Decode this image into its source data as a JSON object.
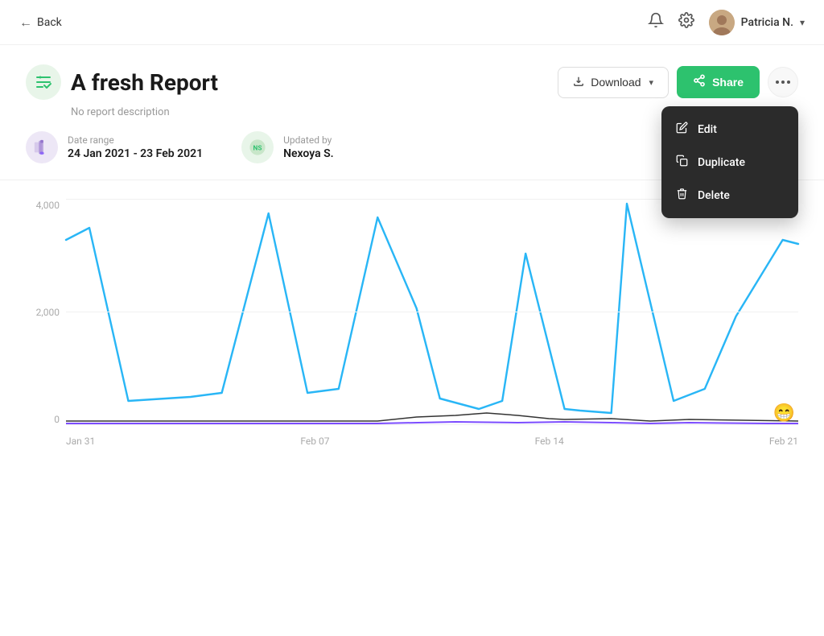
{
  "nav": {
    "back_label": "Back",
    "user_name": "Patricia N.",
    "bell_icon": "🔔",
    "gear_icon": "⚙",
    "chevron": "▾"
  },
  "header": {
    "report_icon": "🖱",
    "report_title": "A fresh Report",
    "report_description": "No report description",
    "download_label": "Download",
    "share_label": "Share",
    "more_icon": "•••"
  },
  "meta": {
    "date_range_label": "Date range",
    "date_range_value": "24 Jan 2021 - 23 Feb 2021",
    "updated_by_label": "Updated by",
    "updated_by_value": "Nexoya S."
  },
  "dropdown": {
    "items": [
      {
        "id": "edit",
        "label": "Edit",
        "icon": "✏"
      },
      {
        "id": "duplicate",
        "label": "Duplicate",
        "icon": "⧉"
      },
      {
        "id": "delete",
        "label": "Delete",
        "icon": "🗑"
      }
    ]
  },
  "chart": {
    "y_labels": [
      "0",
      "2,000",
      "4,000"
    ],
    "x_labels": [
      "Jan 31",
      "Feb 07",
      "Feb 14",
      "Feb 21"
    ],
    "emoji": "😁"
  },
  "colors": {
    "green": "#2dc26e",
    "blue_line": "#29b6f6",
    "purple_line": "#7c4dff",
    "dark_line": "#333333",
    "dropdown_bg": "#2b2b2b"
  }
}
